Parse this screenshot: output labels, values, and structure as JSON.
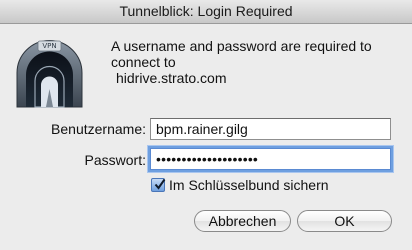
{
  "window": {
    "title": "Tunnelblick: Login Required"
  },
  "app_icon": {
    "name": "tunnelblick-icon",
    "text": "VPN"
  },
  "message": {
    "line1": "A username and password are required to",
    "line2": "connect to",
    "host": "hidrive.strato.com"
  },
  "form": {
    "username_label": "Benutzername:",
    "username_value": "bpm.rainer.gilg",
    "password_label": "Passwort:",
    "password_masked": "••••••••••••••••••••",
    "keychain_label": "Im Schlüsselbund sichern",
    "keychain_checked": true
  },
  "buttons": {
    "cancel": "Abbrechen",
    "ok": "OK"
  },
  "colors": {
    "focus_ring": "#6e9fe0",
    "checkbox_fill": "#6fa0de"
  }
}
